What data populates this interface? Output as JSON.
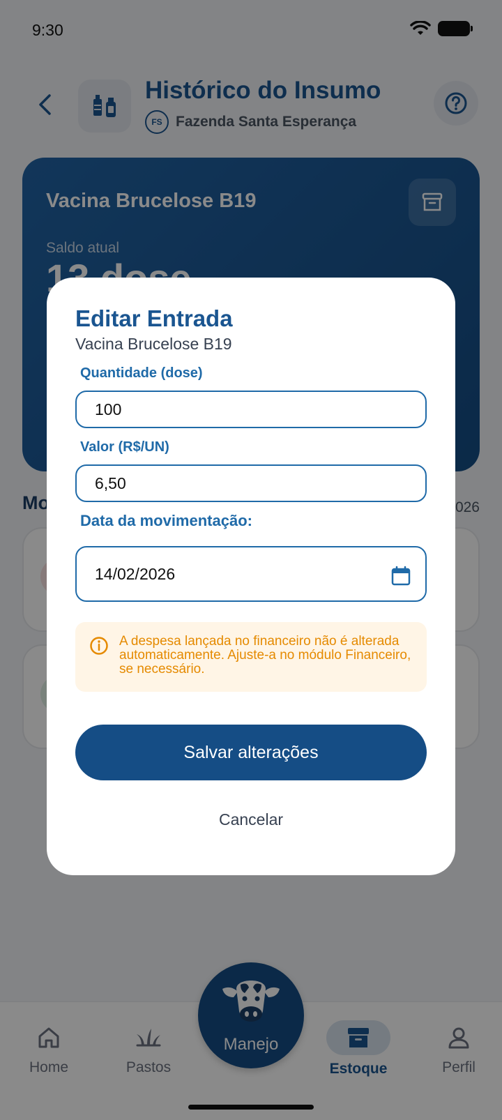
{
  "status_bar": {
    "time": "9:30"
  },
  "header": {
    "title": "Histórico do Insumo",
    "farm_initials": "FS",
    "farm_name": "Fazenda Santa Esperança"
  },
  "stock_card": {
    "name": "Vacina Brucelose B19",
    "balance_label": "Saldo atual",
    "balance_value": "13 dose"
  },
  "movements": {
    "title": "Mo",
    "date_fragment": "026"
  },
  "modal": {
    "title": "Editar Entrada",
    "subtitle": "Vacina Brucelose B19",
    "quantity_label": "Quantidade (dose)",
    "quantity_value": "100",
    "value_label": "Valor (R$/UN)",
    "value_value": "6,50",
    "date_label": "Data da movimentação:",
    "date_value": "14/02/2026",
    "alert_text": "A despesa lançada no financeiro não é alterada automaticamente. Ajuste-a no módulo Financeiro, se necessário.",
    "save_label": "Salvar alterações",
    "cancel_label": "Cancelar"
  },
  "bottom_nav": {
    "home": "Home",
    "pastos": "Pastos",
    "manejo": "Manejo",
    "estoque": "Estoque",
    "perfil": "Perfil"
  },
  "colors": {
    "primary": "#1a5590",
    "primary_dark": "#154d85",
    "accent": "#1f6aa8",
    "warning_text": "#e58a00",
    "warning_bg": "#fff5e6"
  }
}
